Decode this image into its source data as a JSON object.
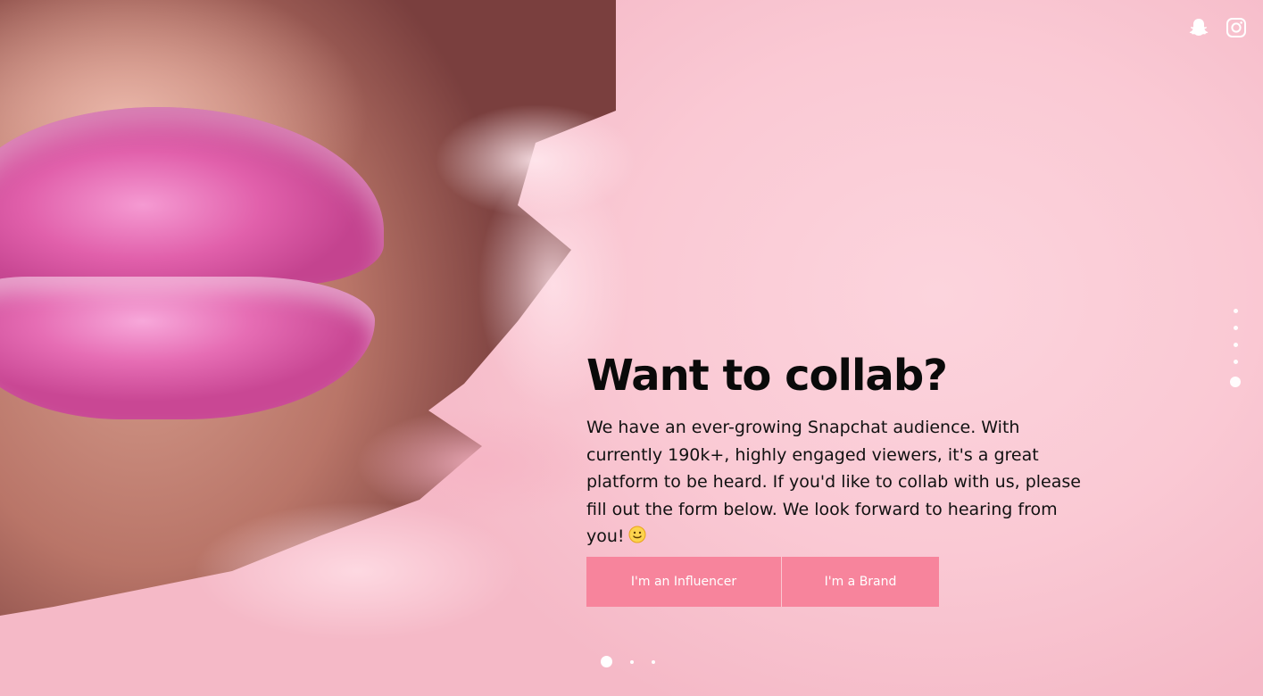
{
  "hero": {
    "title": "Want to collab?",
    "description": "We have an ever-growing Snapchat audience. With currently 190k+, highly engaged viewers, it's a great platform to be heard. If you'd like to collab with us, please fill out the form below. We look forward to hearing from you!"
  },
  "buttons": {
    "influencer_label": "I'm an Influencer",
    "brand_label": "I'm a Brand"
  },
  "social": {
    "icons": [
      "snapchat-icon",
      "instagram-icon"
    ]
  },
  "side_nav": {
    "count": 5,
    "active_index": 4
  },
  "slider": {
    "count": 3,
    "active_index": 0
  },
  "colors": {
    "background": "#f9c9d4",
    "button": "#f7849c",
    "title": "#0a0a0a",
    "lips": "#e160ab"
  }
}
